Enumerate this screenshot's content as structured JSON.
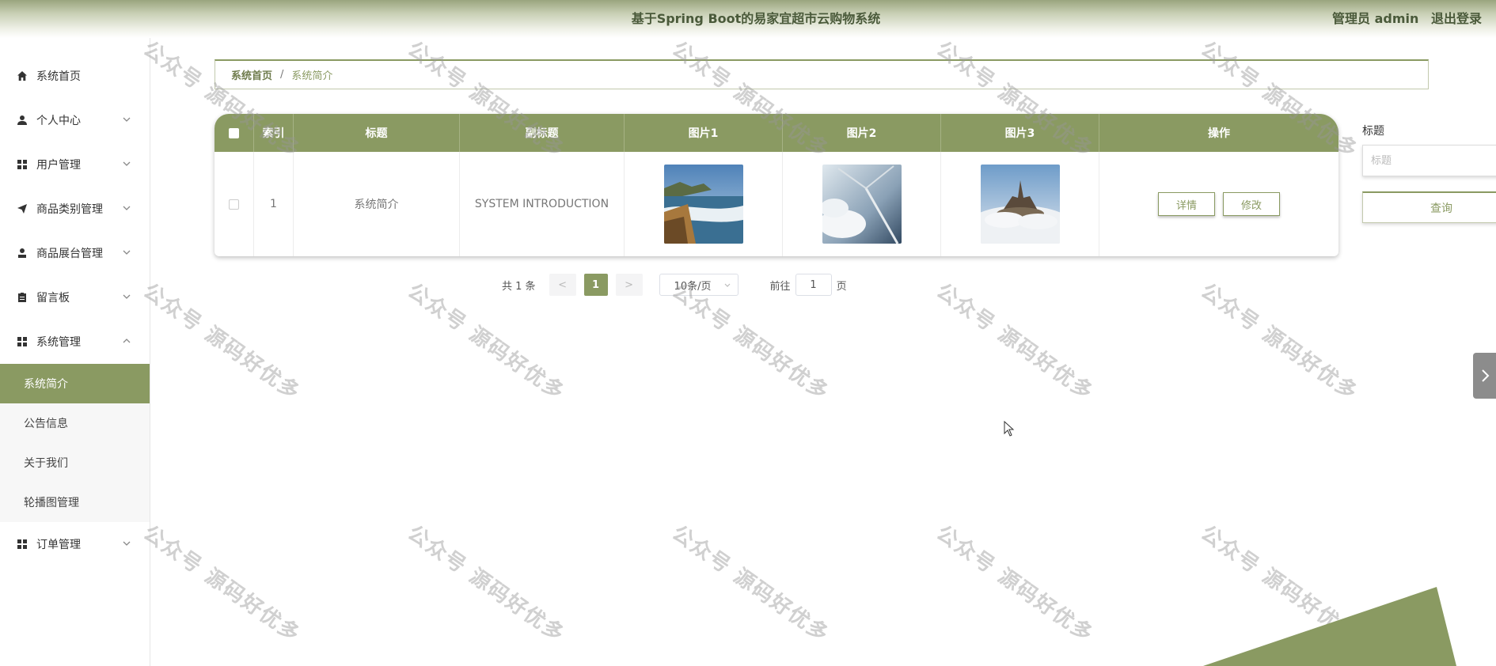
{
  "header": {
    "title": "基于Spring Boot的易家宜超市云购物系统",
    "user": "管理员 admin",
    "logout": "退出登录"
  },
  "sidebar": {
    "items": [
      {
        "label": "系统首页",
        "icon": "home-icon"
      },
      {
        "label": "个人中心",
        "icon": "user-icon"
      },
      {
        "label": "用户管理",
        "icon": "grid-icon"
      },
      {
        "label": "商品类别管理",
        "icon": "send-icon"
      },
      {
        "label": "商品展台管理",
        "icon": "person-icon"
      },
      {
        "label": "留言板",
        "icon": "clipboard-icon"
      },
      {
        "label": "系统管理",
        "icon": "grid-icon"
      },
      {
        "label": "订单管理",
        "icon": "grid-icon"
      }
    ],
    "sub_items": [
      "系统简介",
      "公告信息",
      "关于我们",
      "轮播图管理"
    ]
  },
  "breadcrumb": {
    "home": "系统首页",
    "separator": "/",
    "current": "系统简介"
  },
  "table": {
    "headers": [
      "索引",
      "标题",
      "副标题",
      "图片1",
      "图片2",
      "图片3",
      "操作"
    ],
    "rows": [
      {
        "index": "1",
        "title": "系统简介",
        "subtitle": "SYSTEM INTRODUCTION",
        "detail": "详情",
        "edit": "修改"
      }
    ]
  },
  "pagination": {
    "total": "共 1 条",
    "prev": "<",
    "page": "1",
    "next": ">",
    "page_size": "10条/页",
    "goto_prefix": "前往",
    "goto_value": "1",
    "goto_suffix": "页"
  },
  "search": {
    "label": "标题",
    "placeholder": "标题",
    "button": "查询"
  },
  "watermark": "公众号 源码好优多",
  "colors": {
    "accent": "#8a9a62",
    "header_text": "#4a5a3a"
  }
}
